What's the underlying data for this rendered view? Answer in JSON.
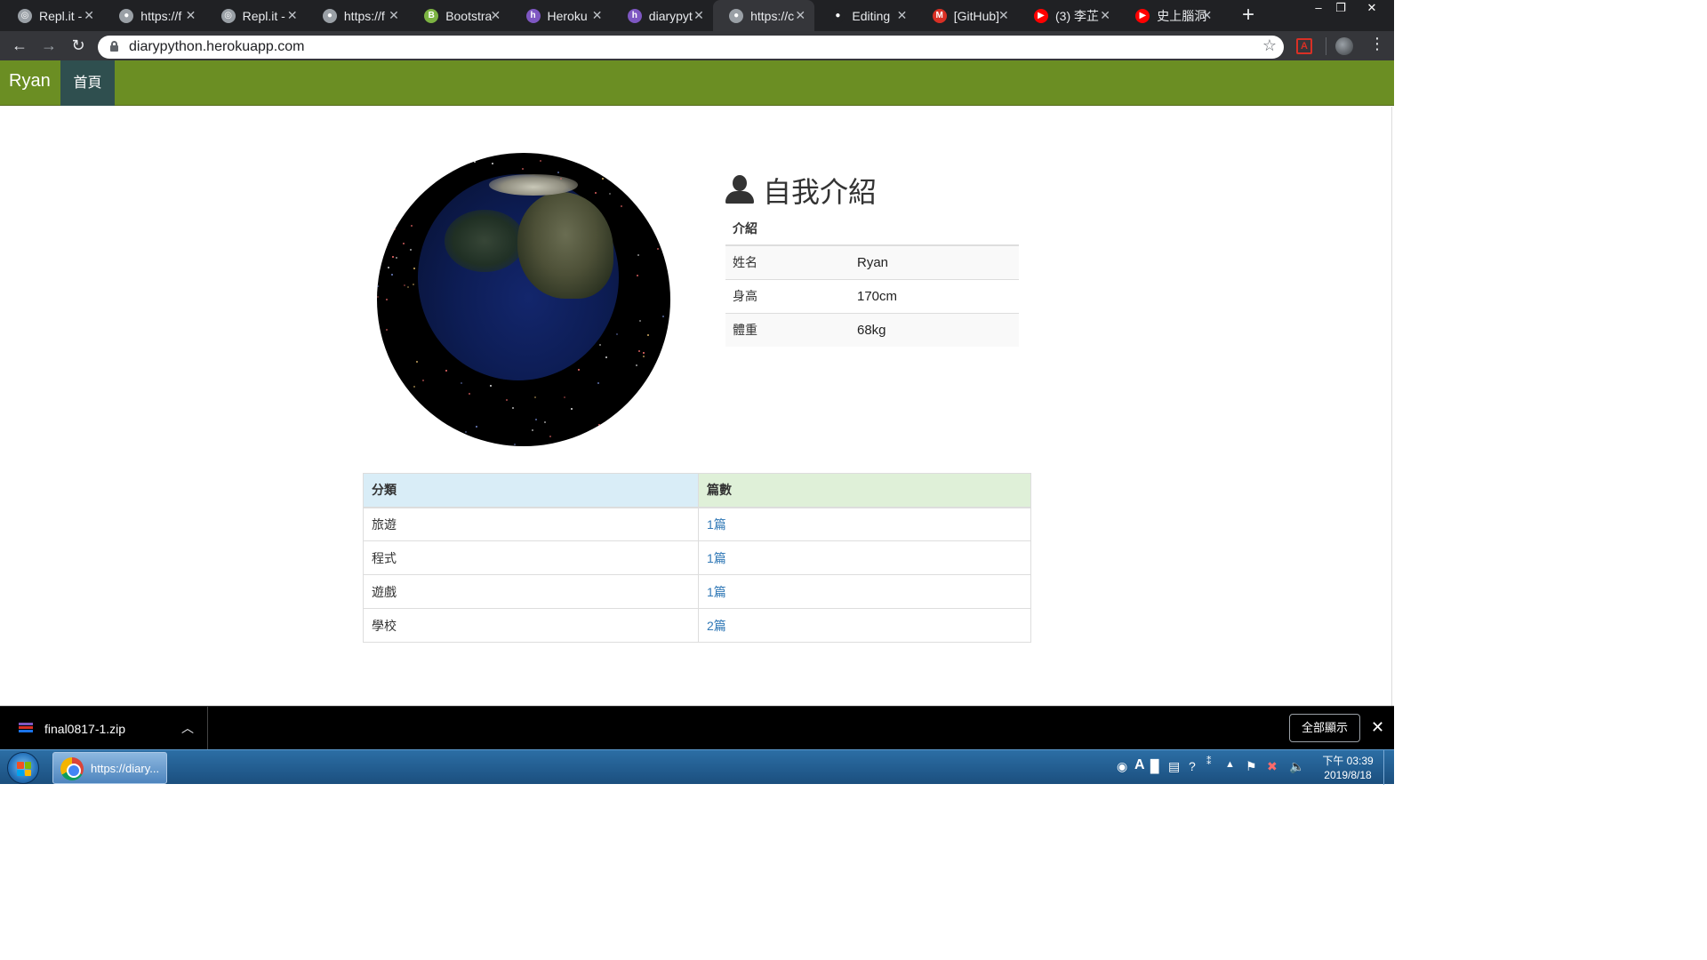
{
  "browser": {
    "tabs": [
      {
        "title": "Repl.it -",
        "icon": "replit-icon",
        "color": "#9aa0a6"
      },
      {
        "title": "https://f",
        "icon": "globe-icon",
        "color": "#9aa0a6"
      },
      {
        "title": "Repl.it -",
        "icon": "replit-icon",
        "color": "#9aa0a6"
      },
      {
        "title": "https://f",
        "icon": "globe-icon",
        "color": "#9aa0a6"
      },
      {
        "title": "Bootstra",
        "icon": "bootstrap-icon",
        "color": "#7cb342"
      },
      {
        "title": "Heroku",
        "icon": "heroku-icon",
        "color": "#7e57c2"
      },
      {
        "title": "diarypyt",
        "icon": "heroku-icon",
        "color": "#7e57c2"
      },
      {
        "title": "https://c",
        "icon": "globe-icon",
        "color": "#9aa0a6",
        "active": true
      },
      {
        "title": "Editing",
        "icon": "github-icon",
        "color": "#202124"
      },
      {
        "title": "[GitHub]",
        "icon": "gmail-icon",
        "color": "#d93025"
      },
      {
        "title": "(3) 李芷",
        "icon": "youtube-icon",
        "color": "#ff0000"
      },
      {
        "title": "史上腦洞",
        "icon": "youtube-icon",
        "color": "#ff0000"
      }
    ],
    "url": "diarypython.herokuapp.com"
  },
  "site": {
    "brand": "Ryan",
    "nav_home": "首頁",
    "colors": {
      "navbar": "#6b8e23",
      "active_nav": "#2f4f4f"
    }
  },
  "profile": {
    "title": "自我介紹",
    "table_header": "介紹",
    "rows": [
      {
        "label": "姓名",
        "value": "Ryan"
      },
      {
        "label": "身高",
        "value": "170cm"
      },
      {
        "label": "體重",
        "value": "68kg"
      }
    ]
  },
  "categories": {
    "header_category": "分類",
    "header_count": "篇數",
    "rows": [
      {
        "name": "旅遊",
        "count": "1篇"
      },
      {
        "name": "程式",
        "count": "1篇"
      },
      {
        "name": "遊戲",
        "count": "1篇"
      },
      {
        "name": "學校",
        "count": "2篇"
      }
    ]
  },
  "downloads": {
    "file": "final0817-1.zip",
    "show_all": "全部顯示"
  },
  "taskbar": {
    "chrome_label": "https://diary...",
    "time": "下午 03:39",
    "date": "2019/8/18"
  }
}
